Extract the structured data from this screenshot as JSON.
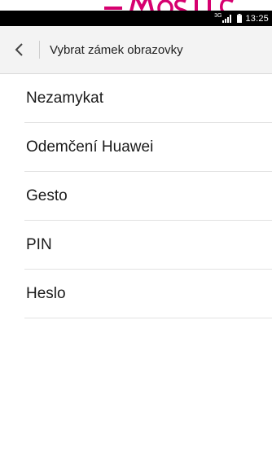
{
  "status_bar": {
    "network_type": "3G",
    "time": "13:25"
  },
  "header": {
    "title": "Vybrat zámek obrazovky"
  },
  "lock_options": [
    {
      "label": "Nezamykat"
    },
    {
      "label": "Odemčení Huawei"
    },
    {
      "label": "Gesto"
    },
    {
      "label": "PIN"
    },
    {
      "label": "Heslo"
    }
  ],
  "colors": {
    "brand": "#d6006f",
    "status_bar_bg": "#000000",
    "header_bg": "#f3f3f3",
    "text": "#1a1a1a"
  },
  "icons": {
    "back": "chevron-left-icon",
    "signal": "signal-icon",
    "battery": "battery-icon"
  }
}
